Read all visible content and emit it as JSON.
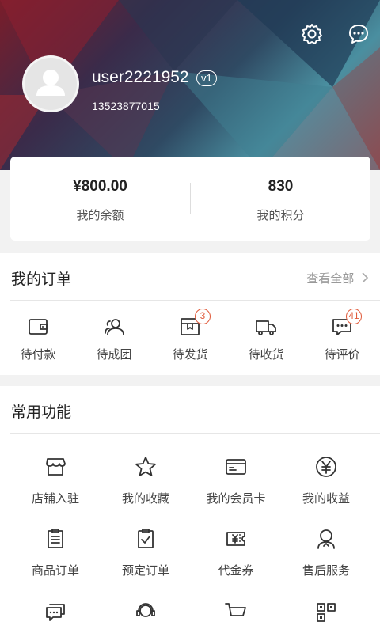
{
  "profile": {
    "username": "user2221952",
    "level": "v1",
    "phone": "13523877015"
  },
  "stats": {
    "balance_value": "¥800.00",
    "balance_label": "我的余额",
    "points_value": "830",
    "points_label": "我的积分"
  },
  "orders": {
    "title": "我的订单",
    "view_all": "查看全部",
    "items": [
      {
        "label": "待付款",
        "icon": "wallet-icon"
      },
      {
        "label": "待成团",
        "icon": "group-icon"
      },
      {
        "label": "待发货",
        "icon": "box-icon",
        "badge": "3"
      },
      {
        "label": "待收货",
        "icon": "truck-icon"
      },
      {
        "label": "待评价",
        "icon": "comment-icon",
        "badge": "41"
      }
    ]
  },
  "functions": {
    "title": "常用功能",
    "items": [
      {
        "label": "店铺入驻",
        "icon": "store-icon"
      },
      {
        "label": "我的收藏",
        "icon": "star-icon"
      },
      {
        "label": "我的会员卡",
        "icon": "card-icon"
      },
      {
        "label": "我的收益",
        "icon": "yen-icon"
      },
      {
        "label": "商品订单",
        "icon": "clipboard-icon"
      },
      {
        "label": "预定订单",
        "icon": "clipboard-check-icon"
      },
      {
        "label": "代金券",
        "icon": "coupon-icon"
      },
      {
        "label": "售后服务",
        "icon": "support-person-icon"
      },
      {
        "label": "",
        "icon": "chat-bubbles-icon"
      },
      {
        "label": "",
        "icon": "headset-icon"
      },
      {
        "label": "",
        "icon": "cart-icon"
      },
      {
        "label": "",
        "icon": "qrcode-icon"
      }
    ]
  },
  "colors": {
    "badge": "#e05a3a",
    "text": "#333333",
    "muted": "#999999"
  }
}
